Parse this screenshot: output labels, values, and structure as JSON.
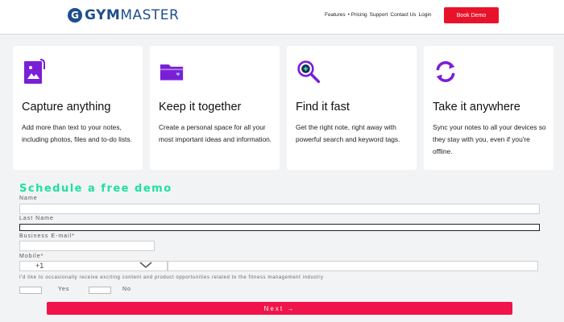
{
  "header": {
    "logo_letter": "G",
    "logo_gym": "GYM",
    "logo_master": "MASTER",
    "nav": [
      "Features",
      "• Pricing",
      "Support",
      "Contact Us",
      "Login"
    ],
    "book_demo": "Book Demo"
  },
  "cards": [
    {
      "title": "Capture anything",
      "text": "Add more than text to your notes, including photos, files and to-do lists.",
      "icon": "notebook-image-icon"
    },
    {
      "title": "Keep it together",
      "text": "Create a personal space for all your most important ideas and information.",
      "icon": "folder-heart-icon"
    },
    {
      "title": "Find it fast",
      "text": "Get the right note, right away with powerful search and keyword tags.",
      "icon": "magnifier-icon"
    },
    {
      "title": "Take it anywhere",
      "text": "Sync your notes to all your devices so they stay with you, even if you're offline.",
      "icon": "sync-icon"
    }
  ],
  "form": {
    "title": "Schedule a free demo",
    "name_label": "Name",
    "last_name_label": "Last Name",
    "email_label": "Business E-mail*",
    "mobile_label": "Mobile*",
    "country_code": "+1",
    "consent": "I'd like to occasionally receive exciting content and product opportunities related to the fitness management industry",
    "yes": "Yes",
    "no": "No",
    "next": "Next  →"
  },
  "colors": {
    "brand": "#1e4e8c",
    "accent": "#e8132b",
    "icon": "#7a1fd6",
    "form_title": "#1ee0a0"
  }
}
